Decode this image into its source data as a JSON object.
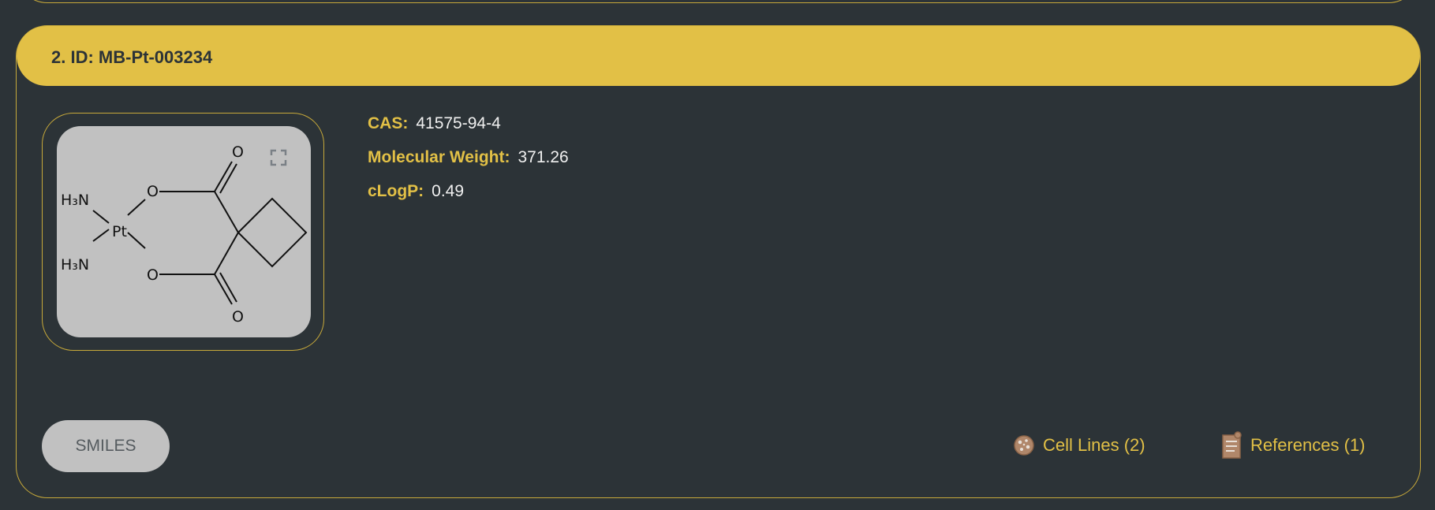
{
  "card": {
    "title": "2. ID: MB-Pt-003234"
  },
  "molecule": {
    "atoms": {
      "upper_nh3": "H₃N",
      "lower_nh3": "H₃N",
      "pt": "Pt",
      "o1": "O",
      "o2": "O",
      "o3": "O",
      "o4": "O"
    },
    "expand_icon": "expand-icon"
  },
  "properties": [
    {
      "key": "CAS:",
      "value": "41575-94-4"
    },
    {
      "key": "Molecular Weight:",
      "value": "371.26"
    },
    {
      "key": "cLogP:",
      "value": "0.49"
    }
  ],
  "actions": {
    "smiles_label": "SMILES",
    "cell_lines_label": "Cell Lines (2)",
    "references_label": "References (1)",
    "cell_lines_icon": "cell-culture-icon",
    "references_icon": "document-icon"
  },
  "colors": {
    "background": "#2c3337",
    "accent": "#e2c046",
    "panel": "#c1c1c1"
  }
}
